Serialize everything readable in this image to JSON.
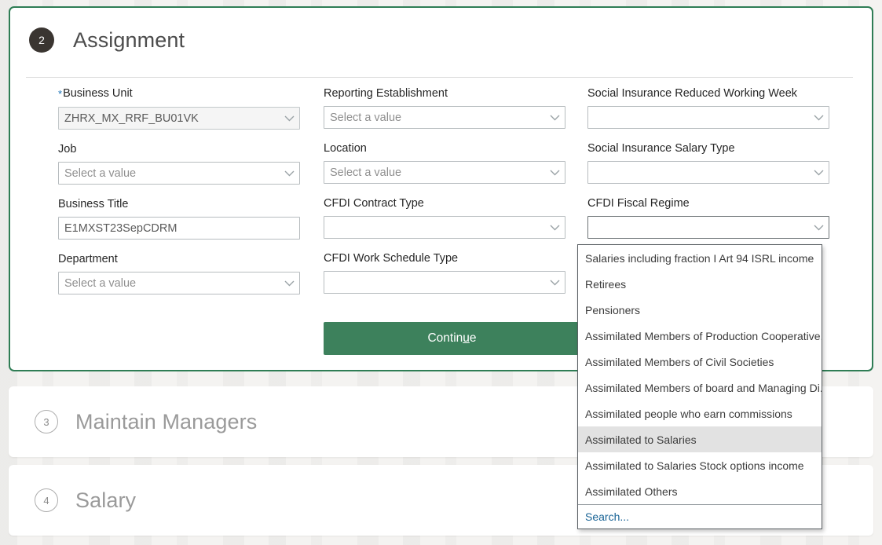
{
  "colors": {
    "accent_green": "#3d815c",
    "card_border_green": "#2f7d55",
    "badge_dark": "#3a3531",
    "link_blue": "#1a6496",
    "required_star_blue": "#1a73b8",
    "page_background": "#f4f3f1",
    "dropdown_selected_bg": "#e2e2e2"
  },
  "sections": {
    "assignment": {
      "number": "2",
      "title": "Assignment"
    },
    "maintain_managers": {
      "number": "3",
      "title": "Maintain Managers"
    },
    "salary": {
      "number": "4",
      "title": "Salary"
    }
  },
  "form": {
    "column_1": [
      {
        "label": "Business Unit",
        "required": true,
        "value": "ZHRX_MX_RRF_BU01VK",
        "placeholder": "",
        "type": "select",
        "readonly": true
      },
      {
        "label": "Job",
        "required": false,
        "value": "",
        "placeholder": "Select a value",
        "type": "select",
        "readonly": false
      },
      {
        "label": "Business Title",
        "required": false,
        "value": "E1MXST23SepCDRM",
        "placeholder": "",
        "type": "text",
        "readonly": false
      },
      {
        "label": "Department",
        "required": false,
        "value": "",
        "placeholder": "Select a value",
        "type": "select",
        "readonly": false
      }
    ],
    "column_2": [
      {
        "label": "Reporting Establishment",
        "required": false,
        "value": "",
        "placeholder": "Select a value",
        "type": "select",
        "readonly": false
      },
      {
        "label": "Location",
        "required": false,
        "value": "",
        "placeholder": "Select a value",
        "type": "select",
        "readonly": false
      },
      {
        "label": "CFDI Contract Type",
        "required": false,
        "value": "",
        "placeholder": "",
        "type": "select",
        "readonly": false
      },
      {
        "label": "CFDI Work Schedule Type",
        "required": false,
        "value": "",
        "placeholder": "",
        "type": "select",
        "readonly": false
      }
    ],
    "column_3": [
      {
        "label": "Social Insurance Reduced Working Week",
        "required": false,
        "value": "",
        "placeholder": "",
        "type": "select",
        "readonly": false
      },
      {
        "label": "Social Insurance Salary Type",
        "required": false,
        "value": "",
        "placeholder": "",
        "type": "select",
        "readonly": false
      },
      {
        "label": "CFDI Fiscal Regime",
        "required": false,
        "value": "",
        "placeholder": "",
        "type": "select",
        "readonly": false,
        "expanded": true
      }
    ]
  },
  "continue_button": {
    "label_before": "Contin",
    "label_accesskey": "u",
    "label_after": "e",
    "label_full": "Continue"
  },
  "fiscal_regime_dropdown": {
    "options": [
      "Salaries including fraction I Art 94 ISRL income",
      "Retirees",
      "Pensioners",
      "Assimilated Members of Production Cooperative...",
      "Assimilated Members of Civil Societies",
      "Assimilated Members of board and Managing Di...",
      "Assimilated people who earn commissions",
      "Assimilated to Salaries",
      "Assimilated to Salaries Stock options income",
      "Assimilated Others"
    ],
    "selected_index": 7,
    "search_label": "Search..."
  }
}
